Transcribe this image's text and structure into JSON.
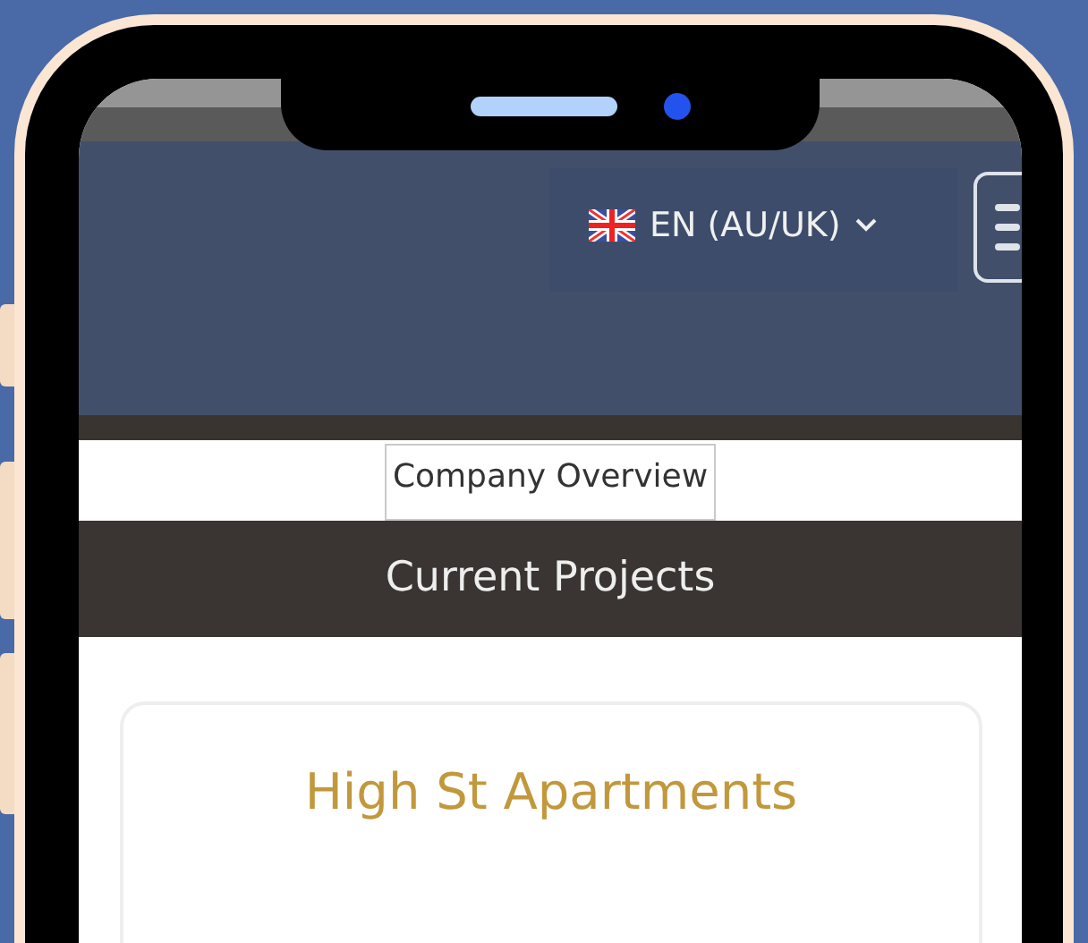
{
  "navbar": {
    "language": {
      "label": "EN (AU/UK)"
    }
  },
  "nav_link": {
    "label": "Company Overview"
  },
  "section_title": "Current Projects",
  "projects": [
    {
      "title": "High St Apartments"
    }
  ]
}
